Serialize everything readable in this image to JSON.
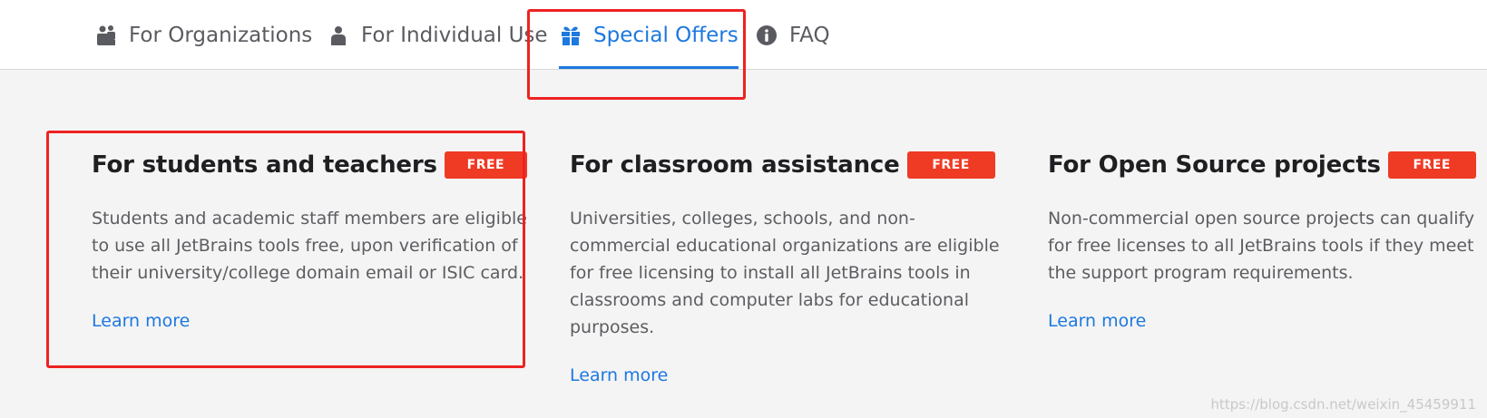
{
  "nav": {
    "tabs": [
      {
        "label": "For Organizations",
        "icon": "organization-icon",
        "active": false
      },
      {
        "label": "For Individual Use",
        "icon": "person-icon",
        "active": false
      },
      {
        "label": "Special Offers",
        "icon": "gift-icon",
        "active": true
      },
      {
        "label": "FAQ",
        "icon": "info-icon",
        "active": false
      }
    ]
  },
  "offers": [
    {
      "title": "For students and teachers",
      "badge": "FREE",
      "description": "Students and academic staff members are eligible to use all JetBrains tools free, upon verification of their university/college domain email or ISIC card.",
      "link": "Learn more"
    },
    {
      "title": "For classroom assistance",
      "badge": "FREE",
      "description": "Universities, colleges, schools, and non-commercial educational organizations are eligible for free licensing to install all JetBrains tools in classrooms and computer labs for educational purposes.",
      "link": "Learn more"
    },
    {
      "title": "For Open Source projects",
      "badge": "FREE",
      "description": "Non-commercial open source projects can qualify for free licenses to all JetBrains tools if they meet the support program requirements.",
      "link": "Learn more"
    }
  ],
  "watermark": "https://blog.csdn.net/weixin_45459911",
  "colors": {
    "accent": "#1d78e0",
    "badge": "#ef3a24",
    "annotation": "#ee2222",
    "background": "#f4f4f4"
  }
}
